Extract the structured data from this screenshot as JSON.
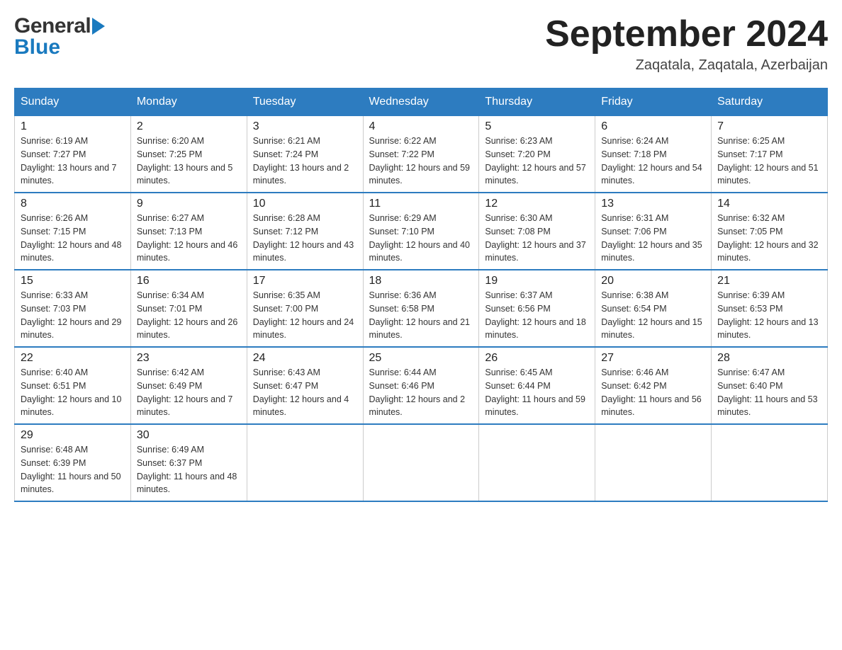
{
  "header": {
    "logo": {
      "general": "General",
      "blue": "Blue"
    },
    "title": "September 2024",
    "location": "Zaqatala, Zaqatala, Azerbaijan"
  },
  "days_of_week": [
    "Sunday",
    "Monday",
    "Tuesday",
    "Wednesday",
    "Thursday",
    "Friday",
    "Saturday"
  ],
  "weeks": [
    [
      {
        "day": "1",
        "sunrise": "6:19 AM",
        "sunset": "7:27 PM",
        "daylight": "13 hours and 7 minutes."
      },
      {
        "day": "2",
        "sunrise": "6:20 AM",
        "sunset": "7:25 PM",
        "daylight": "13 hours and 5 minutes."
      },
      {
        "day": "3",
        "sunrise": "6:21 AM",
        "sunset": "7:24 PM",
        "daylight": "13 hours and 2 minutes."
      },
      {
        "day": "4",
        "sunrise": "6:22 AM",
        "sunset": "7:22 PM",
        "daylight": "12 hours and 59 minutes."
      },
      {
        "day": "5",
        "sunrise": "6:23 AM",
        "sunset": "7:20 PM",
        "daylight": "12 hours and 57 minutes."
      },
      {
        "day": "6",
        "sunrise": "6:24 AM",
        "sunset": "7:18 PM",
        "daylight": "12 hours and 54 minutes."
      },
      {
        "day": "7",
        "sunrise": "6:25 AM",
        "sunset": "7:17 PM",
        "daylight": "12 hours and 51 minutes."
      }
    ],
    [
      {
        "day": "8",
        "sunrise": "6:26 AM",
        "sunset": "7:15 PM",
        "daylight": "12 hours and 48 minutes."
      },
      {
        "day": "9",
        "sunrise": "6:27 AM",
        "sunset": "7:13 PM",
        "daylight": "12 hours and 46 minutes."
      },
      {
        "day": "10",
        "sunrise": "6:28 AM",
        "sunset": "7:12 PM",
        "daylight": "12 hours and 43 minutes."
      },
      {
        "day": "11",
        "sunrise": "6:29 AM",
        "sunset": "7:10 PM",
        "daylight": "12 hours and 40 minutes."
      },
      {
        "day": "12",
        "sunrise": "6:30 AM",
        "sunset": "7:08 PM",
        "daylight": "12 hours and 37 minutes."
      },
      {
        "day": "13",
        "sunrise": "6:31 AM",
        "sunset": "7:06 PM",
        "daylight": "12 hours and 35 minutes."
      },
      {
        "day": "14",
        "sunrise": "6:32 AM",
        "sunset": "7:05 PM",
        "daylight": "12 hours and 32 minutes."
      }
    ],
    [
      {
        "day": "15",
        "sunrise": "6:33 AM",
        "sunset": "7:03 PM",
        "daylight": "12 hours and 29 minutes."
      },
      {
        "day": "16",
        "sunrise": "6:34 AM",
        "sunset": "7:01 PM",
        "daylight": "12 hours and 26 minutes."
      },
      {
        "day": "17",
        "sunrise": "6:35 AM",
        "sunset": "7:00 PM",
        "daylight": "12 hours and 24 minutes."
      },
      {
        "day": "18",
        "sunrise": "6:36 AM",
        "sunset": "6:58 PM",
        "daylight": "12 hours and 21 minutes."
      },
      {
        "day": "19",
        "sunrise": "6:37 AM",
        "sunset": "6:56 PM",
        "daylight": "12 hours and 18 minutes."
      },
      {
        "day": "20",
        "sunrise": "6:38 AM",
        "sunset": "6:54 PM",
        "daylight": "12 hours and 15 minutes."
      },
      {
        "day": "21",
        "sunrise": "6:39 AM",
        "sunset": "6:53 PM",
        "daylight": "12 hours and 13 minutes."
      }
    ],
    [
      {
        "day": "22",
        "sunrise": "6:40 AM",
        "sunset": "6:51 PM",
        "daylight": "12 hours and 10 minutes."
      },
      {
        "day": "23",
        "sunrise": "6:42 AM",
        "sunset": "6:49 PM",
        "daylight": "12 hours and 7 minutes."
      },
      {
        "day": "24",
        "sunrise": "6:43 AM",
        "sunset": "6:47 PM",
        "daylight": "12 hours and 4 minutes."
      },
      {
        "day": "25",
        "sunrise": "6:44 AM",
        "sunset": "6:46 PM",
        "daylight": "12 hours and 2 minutes."
      },
      {
        "day": "26",
        "sunrise": "6:45 AM",
        "sunset": "6:44 PM",
        "daylight": "11 hours and 59 minutes."
      },
      {
        "day": "27",
        "sunrise": "6:46 AM",
        "sunset": "6:42 PM",
        "daylight": "11 hours and 56 minutes."
      },
      {
        "day": "28",
        "sunrise": "6:47 AM",
        "sunset": "6:40 PM",
        "daylight": "11 hours and 53 minutes."
      }
    ],
    [
      {
        "day": "29",
        "sunrise": "6:48 AM",
        "sunset": "6:39 PM",
        "daylight": "11 hours and 50 minutes."
      },
      {
        "day": "30",
        "sunrise": "6:49 AM",
        "sunset": "6:37 PM",
        "daylight": "11 hours and 48 minutes."
      },
      null,
      null,
      null,
      null,
      null
    ]
  ],
  "labels": {
    "sunrise": "Sunrise:",
    "sunset": "Sunset:",
    "daylight": "Daylight:"
  }
}
